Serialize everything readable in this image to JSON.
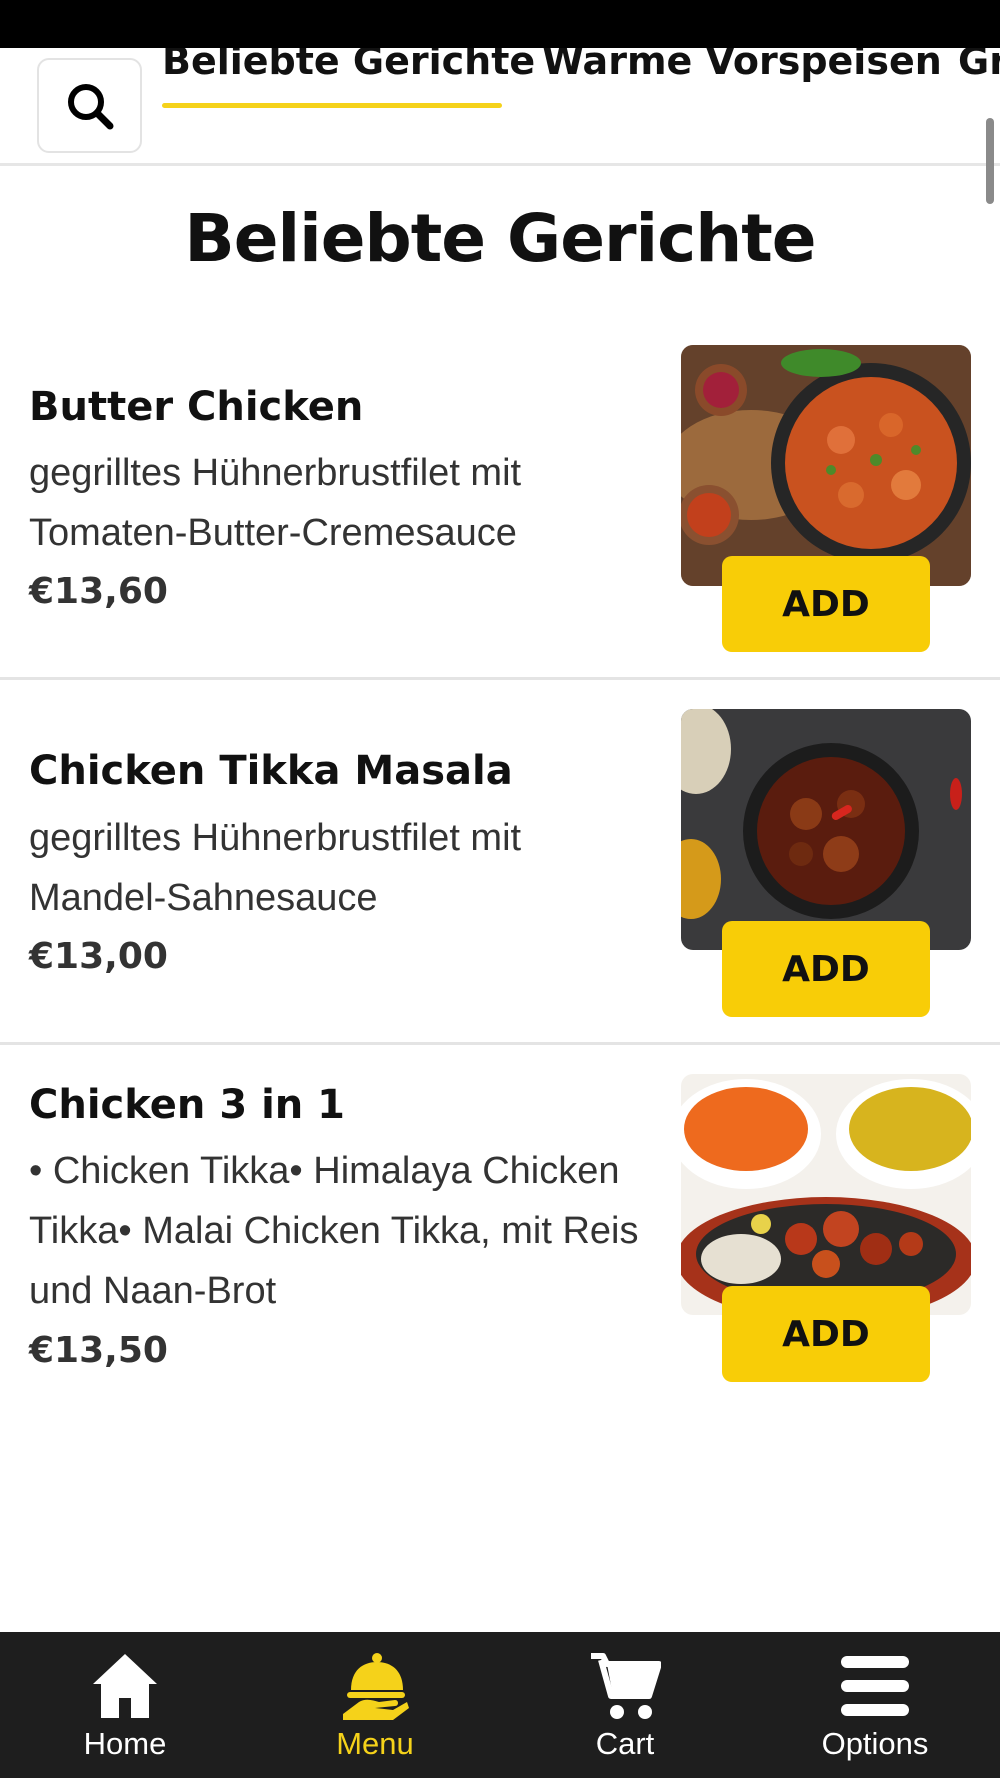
{
  "colors": {
    "accent": "#f8cd07",
    "nav_bg": "#1e1e1e",
    "active_nav": "#f5d21a",
    "inactive_nav": "#ffffff"
  },
  "header": {
    "search_icon": "search-icon",
    "tabs": [
      {
        "label": "Beliebte Gerichte",
        "active": true
      },
      {
        "label": "Warme Vorspeisen",
        "active": false
      },
      {
        "label": "Gr",
        "active": false
      }
    ]
  },
  "section": {
    "title": "Beliebte Gerichte"
  },
  "items": [
    {
      "name": "Butter Chicken",
      "description": "gegrilltes Hühnerbrustfilet mit Tomaten-Butter-Cremesauce",
      "price": "€13,60",
      "add_label": "ADD"
    },
    {
      "name": "Chicken Tikka Masala",
      "description": "gegrilltes Hühnerbrustfilet mit Mandel-Sahnesauce",
      "price": "€13,00",
      "add_label": "ADD"
    },
    {
      "name": "Chicken 3 in 1",
      "description": "• Chicken Tikka• Himalaya Chicken Tikka• Malai Chicken Tikka, mit Reis und Naan-Brot",
      "price": "€13,50",
      "add_label": "ADD"
    }
  ],
  "bottom_nav": [
    {
      "label": "Home",
      "icon": "home-icon",
      "active": false
    },
    {
      "label": "Menu",
      "icon": "food-tray-icon",
      "active": true
    },
    {
      "label": "Cart",
      "icon": "cart-icon",
      "active": false
    },
    {
      "label": "Options",
      "icon": "menu-icon",
      "active": false
    }
  ]
}
